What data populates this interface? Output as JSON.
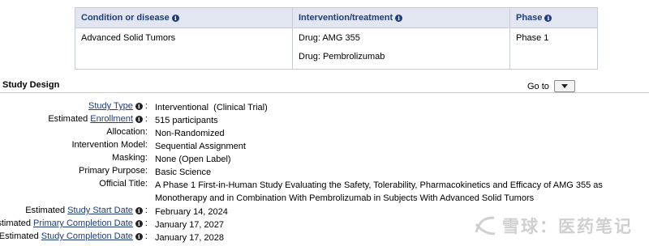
{
  "conditions_table": {
    "headers": [
      "Condition or disease",
      "Intervention/treatment",
      "Phase"
    ],
    "condition": "Advanced Solid Tumors",
    "interventions": [
      "Drug: AMG 355",
      "Drug: Pembrolizumab"
    ],
    "phase": "Phase 1"
  },
  "study_design": {
    "title": "Study Design",
    "goto_label": "Go to",
    "rows": [
      {
        "prefix": "",
        "link": "Study Type",
        "suffix": "",
        "info": true,
        "value": "Interventional  (Clinical Trial)"
      },
      {
        "prefix": "Estimated ",
        "link": "Enrollment",
        "suffix": "",
        "info": true,
        "value": "515 participants"
      },
      {
        "prefix": "Allocation:",
        "link": "",
        "suffix": "",
        "info": false,
        "value": "Non-Randomized"
      },
      {
        "prefix": "Intervention Model:",
        "link": "",
        "suffix": "",
        "info": false,
        "value": "Sequential Assignment"
      },
      {
        "prefix": "Masking:",
        "link": "",
        "suffix": "",
        "info": false,
        "value": "None (Open Label)"
      },
      {
        "prefix": "Primary Purpose:",
        "link": "",
        "suffix": "",
        "info": false,
        "value": "Basic Science"
      },
      {
        "prefix": "Official Title:",
        "link": "",
        "suffix": "",
        "info": false,
        "value": "A Phase 1 First-in-Human Study Evaluating the Safety, Tolerability, Pharmacokinetics and Efficacy of AMG 355 as Monotherapy and in Combination With Pembrolizumab in Subjects With Advanced Solid Tumors"
      },
      {
        "prefix": "Estimated ",
        "link": "Study Start Date",
        "suffix": "",
        "info": true,
        "value": "February 14, 2024"
      },
      {
        "prefix": "Estimated ",
        "link": "Primary Completion Date",
        "suffix": "",
        "info": true,
        "value": "January 17, 2027"
      },
      {
        "prefix": "Estimated ",
        "link": "Study Completion Date",
        "suffix": "",
        "info": true,
        "value": "January 17, 2028"
      }
    ]
  },
  "watermark": {
    "text": "雪球：医药笔记"
  }
}
